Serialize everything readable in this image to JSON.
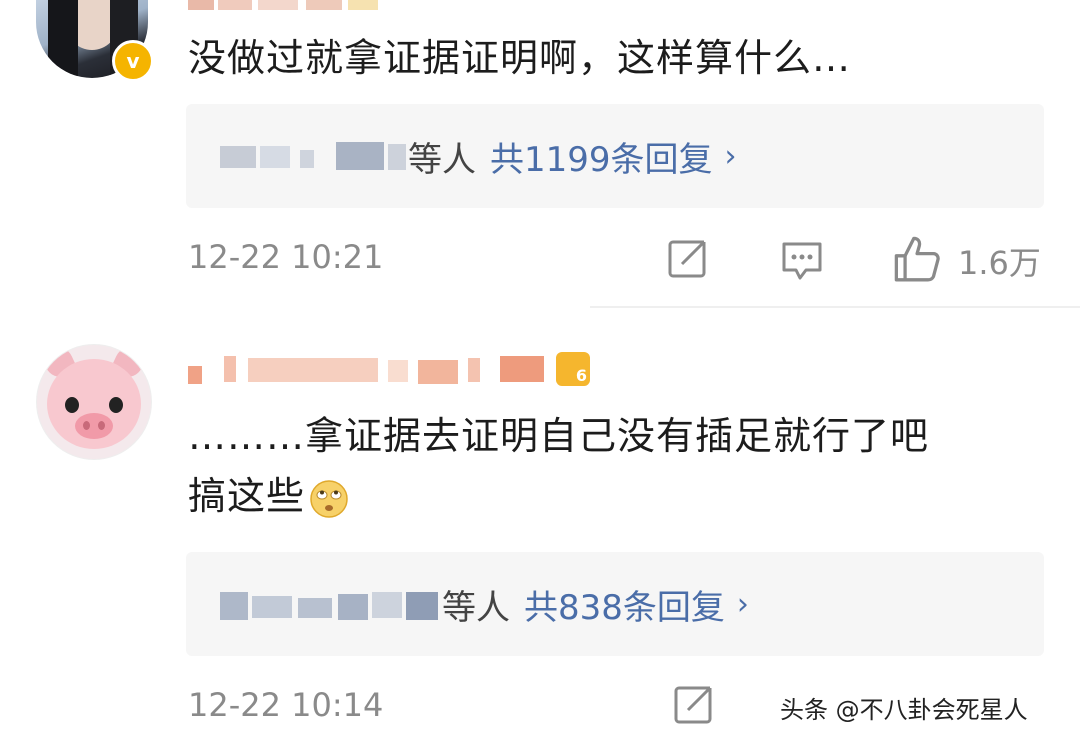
{
  "comments": [
    {
      "text": "没做过就拿证据证明啊，这样算什么…",
      "reply_summary": {
        "suffix": "等人",
        "count": "共1199条回复"
      },
      "timestamp": "12-22 10:21",
      "like_count": "1.6万"
    },
    {
      "text_line1": "………拿证据去证明自己没有插足就行了吧",
      "text_line2": "搞这些",
      "reply_summary": {
        "suffix": "等人",
        "count": "共838条回复"
      },
      "timestamp": "12-22 10:14",
      "level_badge": "6"
    }
  ],
  "icons": {
    "verified": "verified-v-icon",
    "forward": "forward-icon",
    "comment": "comment-icon",
    "like": "thumbs-up-icon",
    "chevron": "chevron-right-icon",
    "emoji": "rolling-eyes-emoji"
  },
  "colors": {
    "link": "#4a6da8",
    "meta": "#8a8a8a",
    "reply_bg": "#f6f6f6",
    "verified": "#f5b400"
  },
  "watermark": "头条 @不八卦会死星人"
}
